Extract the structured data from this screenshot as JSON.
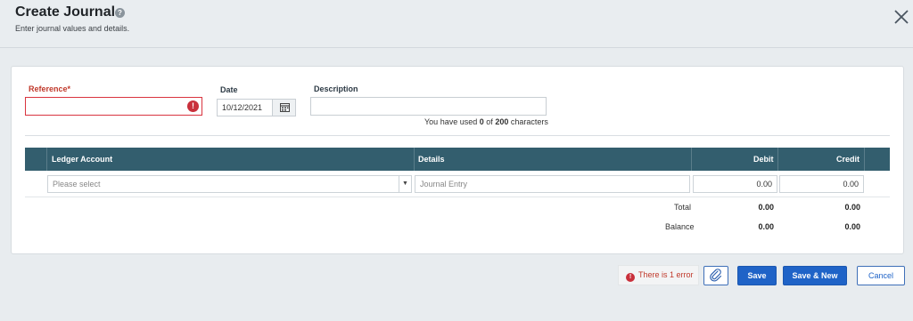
{
  "header": {
    "title": "Create Journal",
    "subtitle": "Enter journal values and details."
  },
  "form": {
    "reference_label": "Reference*",
    "reference_value": "",
    "date_label": "Date",
    "date_value": "10/12/2021",
    "description_label": "Description",
    "description_value": "",
    "char_count": {
      "prefix": "You have used",
      "used": "0",
      "of": "of",
      "max": "200",
      "suffix": "characters"
    }
  },
  "table": {
    "columns": [
      "Ledger Account",
      "Details",
      "Debit",
      "Credit"
    ],
    "row": {
      "ledger_placeholder": "Please select",
      "details_placeholder": "Journal Entry",
      "debit": "0.00",
      "credit": "0.00"
    },
    "total": {
      "label": "Total",
      "debit": "0.00",
      "credit": "0.00"
    },
    "balance": {
      "label": "Balance",
      "debit": "0.00",
      "credit": "0.00"
    }
  },
  "footer": {
    "error_text": "There is 1 error",
    "save_label": "Save",
    "save_new_label": "Save & New",
    "cancel_label": "Cancel"
  },
  "colors": {
    "table_header": "#335e6e",
    "primary": "#1f63c7",
    "error": "#c9303b"
  }
}
